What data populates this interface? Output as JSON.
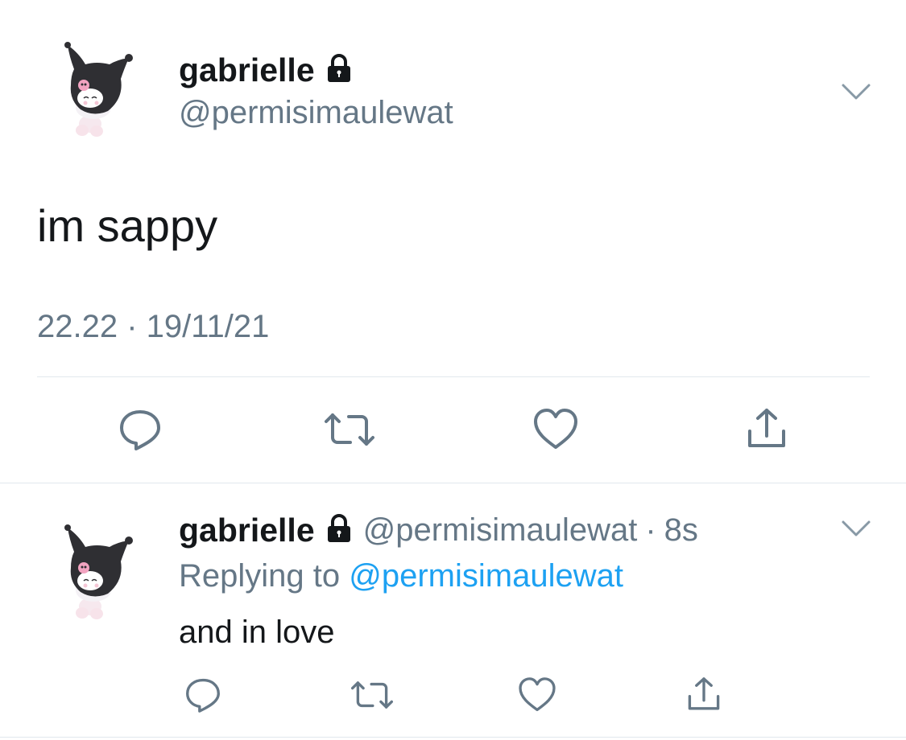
{
  "main_tweet": {
    "display_name": "gabrielle",
    "handle": "@permisimaulewat",
    "text": "im sappy",
    "timestamp": "22.22 · 19/11/21",
    "protected_icon": "lock-icon",
    "menu_icon": "chevron-down-icon",
    "actions": [
      "reply-icon",
      "retweet-icon",
      "like-icon",
      "share-icon"
    ]
  },
  "reply_tweet": {
    "display_name": "gabrielle",
    "handle": "@permisimaulewat",
    "age": "8s",
    "separator": "·",
    "replying_prefix": "Replying to",
    "replying_handle": "@permisimaulewat",
    "text": "and in love",
    "protected_icon": "lock-icon",
    "menu_icon": "chevron-down-icon",
    "actions": [
      "reply-icon",
      "retweet-icon",
      "like-icon",
      "share-icon"
    ]
  },
  "colors": {
    "text": "#14171a",
    "muted": "#657786",
    "link": "#1da1f2",
    "divider": "#e1e8ed"
  }
}
